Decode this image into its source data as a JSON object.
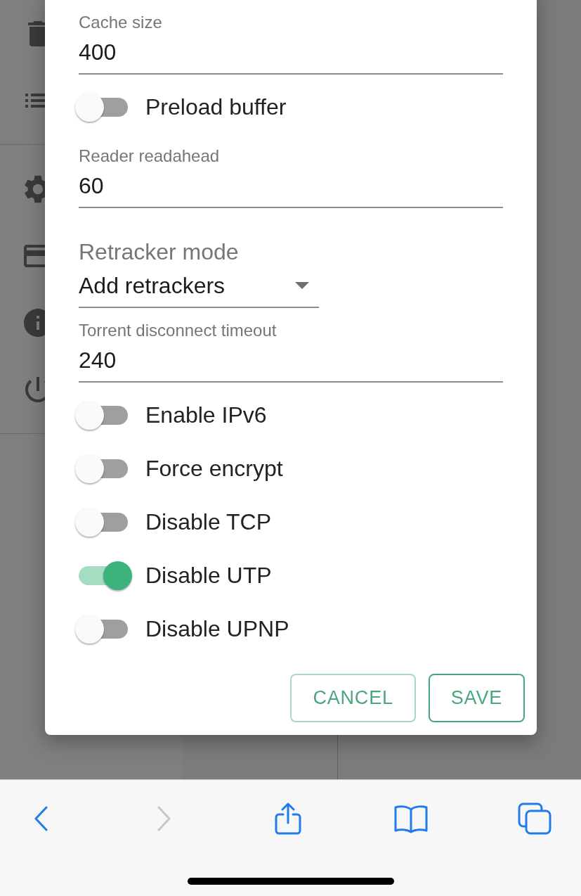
{
  "dialog": {
    "fields": [
      {
        "kind": "text",
        "label": "Cache size",
        "value": "400"
      },
      {
        "kind": "switch",
        "label": "Preload buffer",
        "on": false
      },
      {
        "kind": "text",
        "label": "Reader readahead",
        "value": "60"
      },
      {
        "kind": "select",
        "label": "Retracker mode",
        "value": "Add retrackers"
      },
      {
        "kind": "text",
        "label": "Torrent disconnect timeout",
        "value": "240"
      },
      {
        "kind": "switch",
        "label": "Enable IPv6",
        "on": false
      },
      {
        "kind": "switch",
        "label": "Force encrypt",
        "on": false
      },
      {
        "kind": "switch",
        "label": "Disable TCP",
        "on": false
      },
      {
        "kind": "switch",
        "label": "Disable UTP",
        "on": true
      },
      {
        "kind": "switch",
        "label": "Disable UPNP",
        "on": false
      }
    ],
    "actions": [
      {
        "label": "CANCEL",
        "focused": false
      },
      {
        "label": "SAVE",
        "focused": true
      }
    ]
  },
  "browser_toolbar": [
    {
      "kind": "back",
      "disabled": false
    },
    {
      "kind": "forward",
      "disabled": true
    },
    {
      "kind": "share",
      "disabled": false
    },
    {
      "kind": "bookmarks",
      "disabled": false
    },
    {
      "kind": "tabs",
      "disabled": false
    }
  ]
}
